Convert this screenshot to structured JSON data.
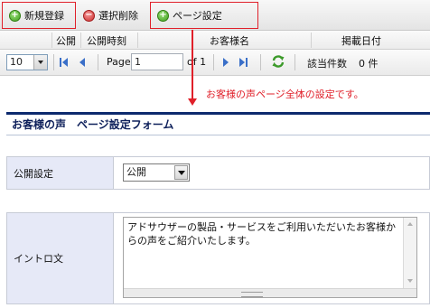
{
  "toolbar": {
    "new_label": "新規登録",
    "delete_label": "選択削除",
    "page_settings_label": "ページ設定"
  },
  "grid": {
    "columns": [
      "公開",
      "公開時刻",
      "お客様名",
      "掲載日付"
    ]
  },
  "pager": {
    "page_size": "10",
    "page_label": "Page",
    "page_value": "1",
    "of_label": "of 1",
    "count_label": "該当件数",
    "count_value": "0 件"
  },
  "annotation": {
    "text": "お客様の声ページ全体の設定です。",
    "color": "#e0202a"
  },
  "form": {
    "title": "お客様の声　ページ設定フォーム",
    "fields": {
      "publish_label": "公開設定",
      "publish_value": "公開",
      "intro_label": "イントロ文",
      "intro_value": "アドサウザーの製品・サービスをご利用いただいたお客様からの声をご紹介いたします。"
    }
  },
  "icons": [
    "add-icon",
    "delete-icon",
    "first-page-icon",
    "prev-page-icon",
    "next-page-icon",
    "last-page-icon",
    "refresh-icon"
  ]
}
